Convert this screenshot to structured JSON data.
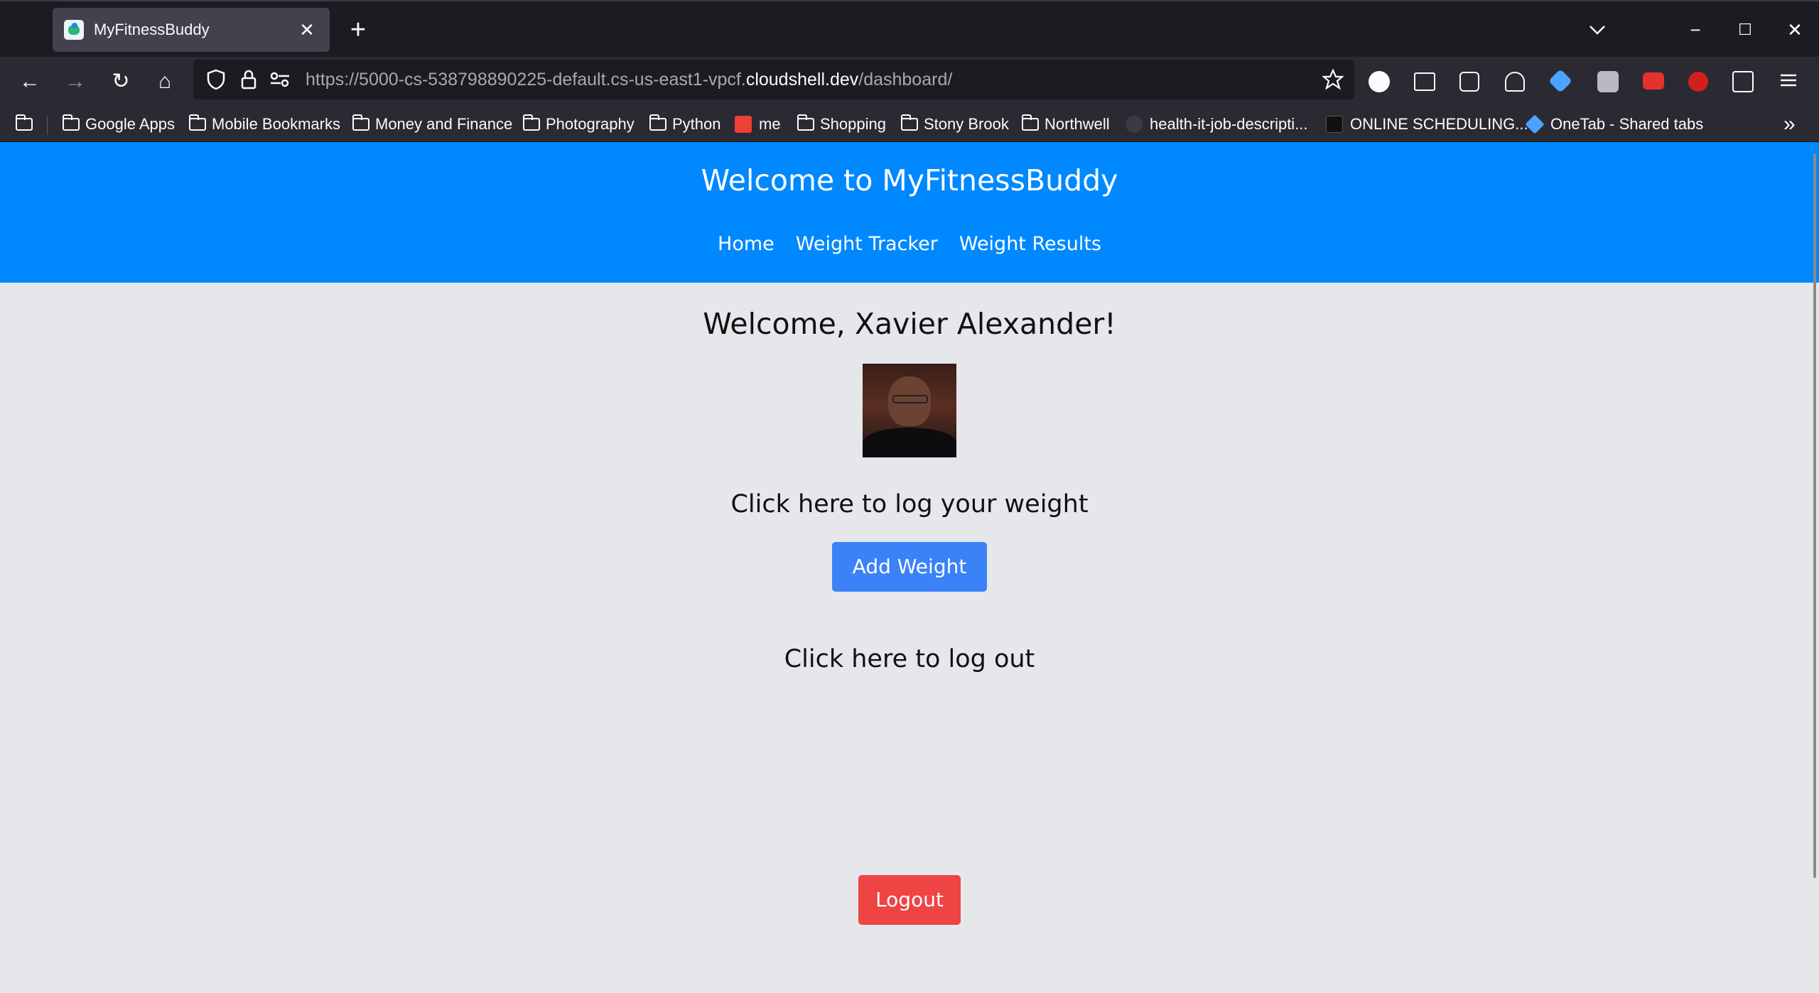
{
  "browser": {
    "tab_title": "MyFitnessBuddy",
    "tab_close": "✕",
    "new_tab": "+",
    "window_controls": {
      "minimize": "−",
      "maximize": "☐",
      "close": "✕"
    },
    "url": {
      "prefix": "https://5000-cs-538798890225-default.cs-us-east1-vpcf.",
      "domain": "cloudshell.dev",
      "suffix": "/dashboard/"
    },
    "nav_icons": {
      "back": "←",
      "forward": "→",
      "reload": "↻",
      "home": "⌂"
    },
    "bookmarks": [
      {
        "label": "Google Apps",
        "type": "folder"
      },
      {
        "label": "Mobile Bookmarks",
        "type": "folder"
      },
      {
        "label": "Money and Finance",
        "type": "folder"
      },
      {
        "label": "Photography",
        "type": "folder"
      },
      {
        "label": "Python",
        "type": "folder"
      },
      {
        "label": "me",
        "type": "link",
        "icon_color": "#ee4035"
      },
      {
        "label": "Shopping",
        "type": "folder"
      },
      {
        "label": "Stony Brook",
        "type": "folder"
      },
      {
        "label": "Northwell",
        "type": "folder"
      },
      {
        "label": "health-it-job-descripti...",
        "type": "link",
        "icon_color": "#3b3b44"
      },
      {
        "label": "ONLINE SCHEDULING...",
        "type": "link",
        "icon_color": "#111111"
      },
      {
        "label": "OneTab - Shared tabs",
        "type": "link",
        "icon_color": "#4aa3ff"
      }
    ],
    "overflow": "»"
  },
  "app": {
    "title": "Welcome to MyFitnessBuddy",
    "nav": [
      "Home",
      "Weight Tracker",
      "Weight Results"
    ],
    "welcome": "Welcome, Xavier Alexander!",
    "log_prompt": "Click here to log your weight",
    "add_weight_label": "Add Weight",
    "logout_prompt": "Click here to log out",
    "logout_label": "Logout"
  },
  "colors": {
    "header_bg": "#0088ff",
    "add_button": "#3b82f6",
    "logout_button": "#ef4444",
    "page_bg": "#e5e7eb"
  }
}
